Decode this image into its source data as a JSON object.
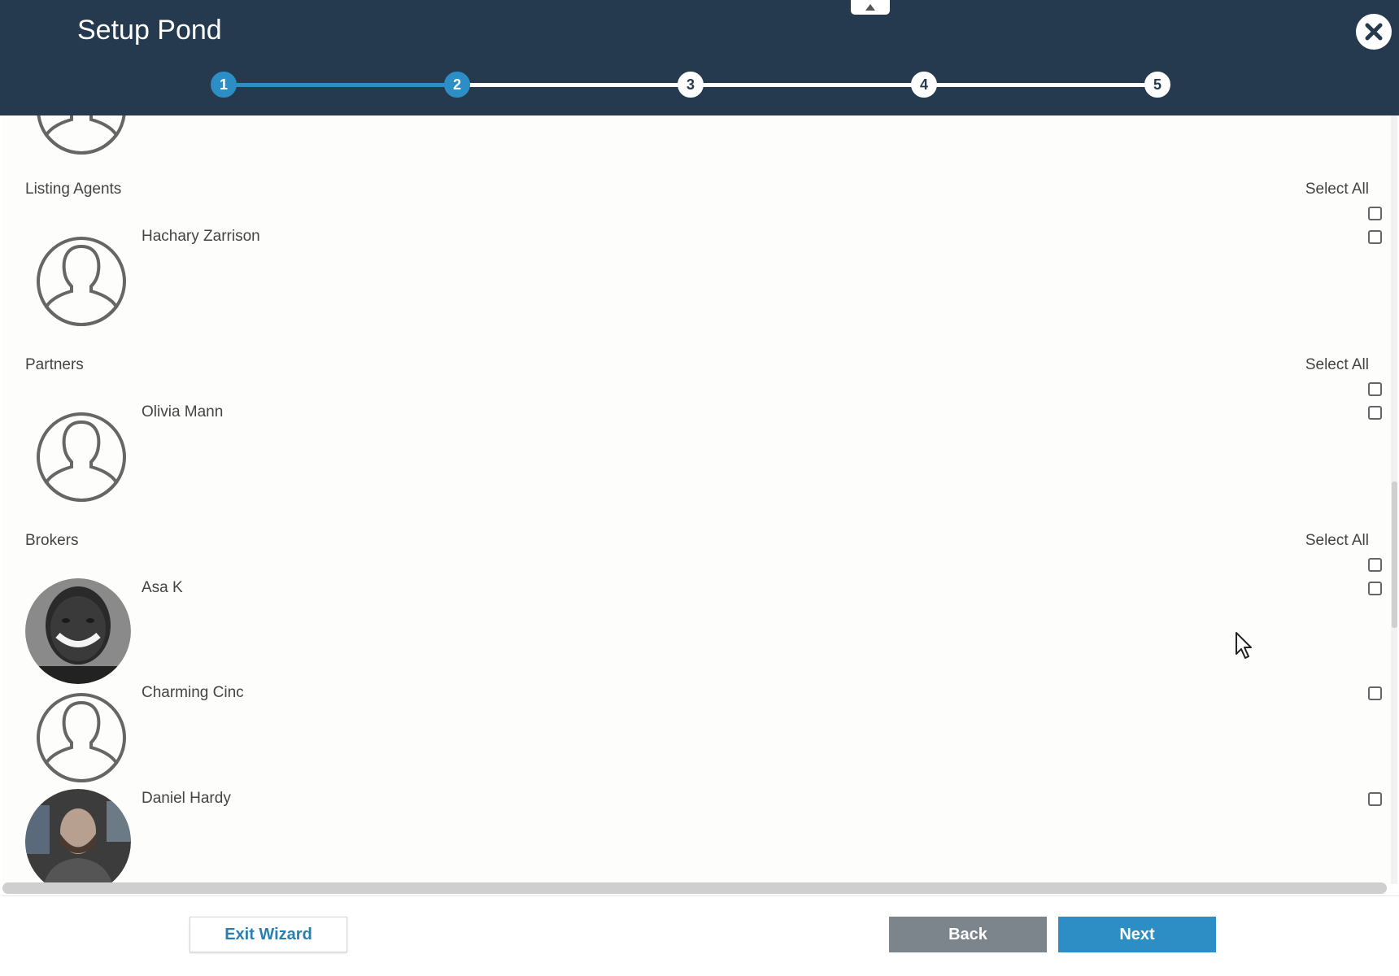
{
  "header": {
    "title": "Setup Pond",
    "steps": [
      "1",
      "2",
      "3",
      "4",
      "5"
    ],
    "current_step": 2,
    "accent_color": "#2c8ec4",
    "background_color": "#263a4f"
  },
  "sections": [
    {
      "label": "Listing Agents",
      "select_all_label": "Select All",
      "people": [
        {
          "name": "Hachary Zarrison",
          "avatar": "default-avatar-icon"
        }
      ]
    },
    {
      "label": "Partners",
      "select_all_label": "Select All",
      "people": [
        {
          "name": "Olivia Mann",
          "avatar": "default-avatar-icon"
        }
      ]
    },
    {
      "label": "Brokers",
      "select_all_label": "Select All",
      "people": [
        {
          "name": "Asa K",
          "avatar": "photo"
        },
        {
          "name": "Charming Cinc",
          "avatar": "default-avatar-icon"
        },
        {
          "name": "Daniel Hardy",
          "avatar": "photo"
        }
      ]
    }
  ],
  "footer": {
    "exit_label": "Exit Wizard",
    "back_label": "Back",
    "next_label": "Next"
  }
}
